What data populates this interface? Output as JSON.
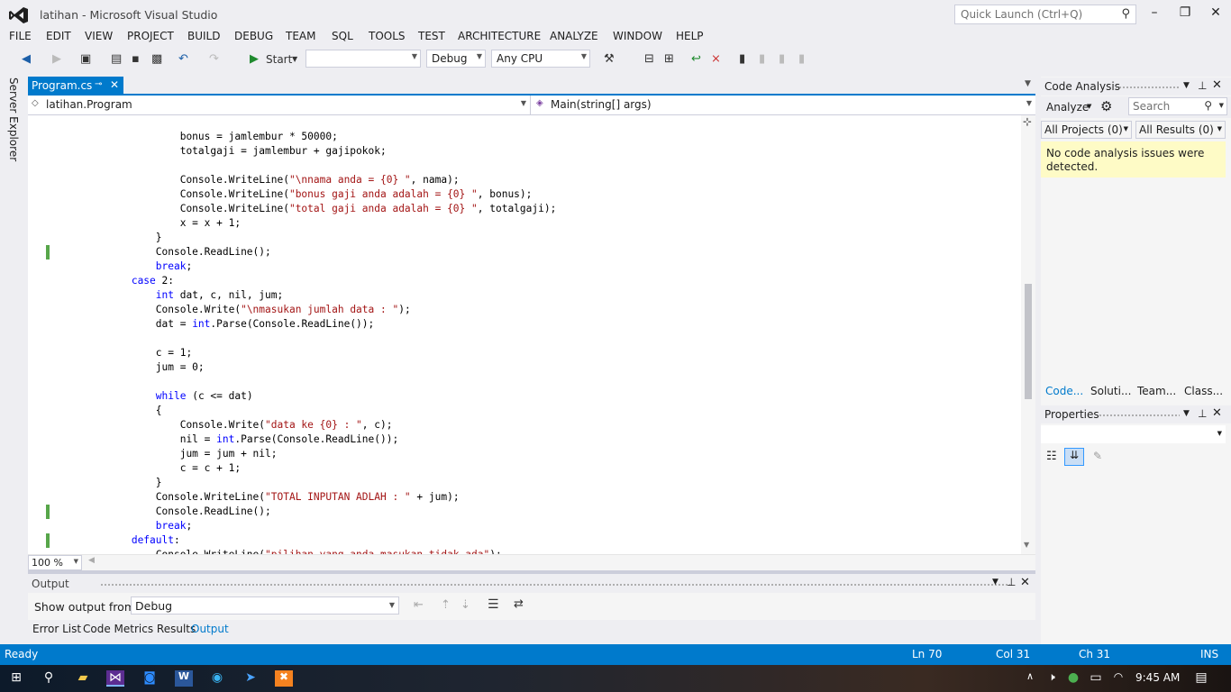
{
  "window": {
    "title": "latihan - Microsoft Visual Studio",
    "quick_launch_placeholder": "Quick Launch (Ctrl+Q)"
  },
  "menu": [
    "FILE",
    "EDIT",
    "VIEW",
    "PROJECT",
    "BUILD",
    "DEBUG",
    "TEAM",
    "SQL",
    "TOOLS",
    "TEST",
    "ARCHITECTURE",
    "ANALYZE",
    "WINDOW",
    "HELP"
  ],
  "toolbar": {
    "start_label": "Start",
    "config": "Debug",
    "platform": "Any CPU"
  },
  "side": {
    "server_explorer": "Server Explorer"
  },
  "editor": {
    "tab": "Program.cs",
    "nav_left": "latihan.Program",
    "nav_right": "Main(string[] args)",
    "zoom": "100 %",
    "code_lines": [
      "                    bonus = jamlembur * 50000;",
      "                    totalgaji = jamlembur + gajipokok;",
      "",
      "                    Console.WriteLine(\"\\nnama anda = {0} \", nama);",
      "                    Console.WriteLine(\"bonus gaji anda adalah = {0} \", bonus);",
      "                    Console.WriteLine(\"total gaji anda adalah = {0} \", totalgaji);",
      "                    x = x + 1;",
      "                }",
      "                Console.ReadLine();",
      "                break;",
      "            case 2:",
      "                int dat, c, nil, jum;",
      "                Console.Write(\"\\nmasukan jumlah data : \");",
      "                dat = int.Parse(Console.ReadLine());",
      "",
      "                c = 1;",
      "                jum = 0;",
      "",
      "                while (c <= dat)",
      "                {",
      "                    Console.Write(\"data ke {0} : \", c);",
      "                    nil = int.Parse(Console.ReadLine());",
      "                    jum = jum + nil;",
      "                    c = c + 1;",
      "                }",
      "                Console.WriteLine(\"TOTAL INPUTAN ADLAH : \" + jum);",
      "                Console.ReadLine();",
      "                break;",
      "            default:",
      "                Console.WriteLine(\"pilihan yang anda masukan tidak ada\");"
    ]
  },
  "output": {
    "title": "Output",
    "show_from_label": "Show output from:",
    "show_from_value": "Debug"
  },
  "bottom_tabs": [
    "Error List",
    "Code Metrics Results",
    "Output"
  ],
  "code_analysis": {
    "title": "Code Analysis",
    "analyze_label": "Analyze",
    "search_placeholder": "Search",
    "projects_filter": "All Projects (0)",
    "results_filter": "All Results (0)",
    "message": "No code analysis issues were detected.",
    "tabs": [
      "Code...",
      "Soluti...",
      "Team...",
      "Class..."
    ]
  },
  "properties": {
    "title": "Properties"
  },
  "status": {
    "ready": "Ready",
    "ln": "Ln 70",
    "col": "Col 31",
    "ch": "Ch 31",
    "ins": "INS"
  },
  "taskbar": {
    "time": "9:45 AM"
  },
  "colors": {
    "accent": "#007acc",
    "keyword": "#0000ff",
    "string": "#a31515",
    "change_bar": "#57a64a",
    "info_bg": "#fefbc6"
  }
}
